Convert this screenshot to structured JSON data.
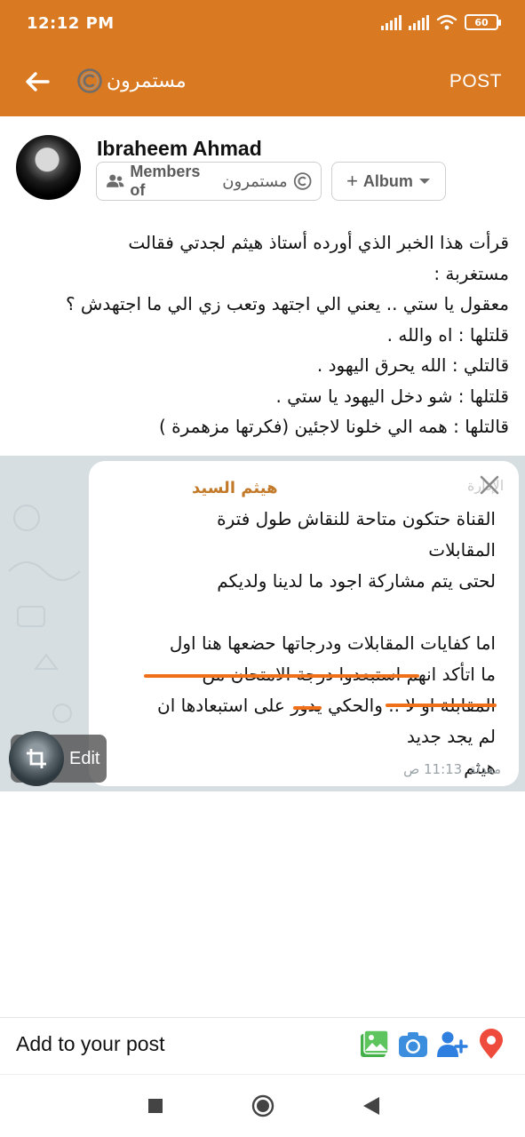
{
  "status_bar": {
    "time": "12:12 PM",
    "battery": "60"
  },
  "header": {
    "back_icon": "arrow-left-icon",
    "title": "مستمرون",
    "post_label": "POST",
    "accent": "#d97a22"
  },
  "author": {
    "name": "Ibraheem Ahmad",
    "audience_label": "Members of",
    "audience_group": "مستمرون",
    "album_label": "Album"
  },
  "post": {
    "lines": [
      "قرأت هذا الخبر الذي أورده أستاذ هيثم لجدتي فقالت",
      "مستغربة :",
      "معقول يا ستي .. يعني الي اجتهد وتعب زي الي ما اجتهدش ؟",
      "قلتلها : اه والله .",
      "قالتلي : الله يحرق اليهود .",
      "قلتلها : شو دخل اليهود يا ستي .",
      "قالتلها : همه الي خلونا لاجئين (فكرتها مزهمرة )"
    ]
  },
  "attached_image": {
    "sender": "هيثم السيد",
    "forward_label": "الإدارة",
    "message_lines": [
      "القناة حتكون متاحة للنقاش طول فترة",
      "المقابلات",
      "لحتى يتم مشاركة اجود ما لدينا ولديكم",
      "",
      "اما كفايات المقابلات ودرجاتها حضعها هنا اول",
      "ما اتأكد انهم استبعدوا درجة الامتحان من",
      "المقابلة او لا .. والحكي يدور على استبعادها ان",
      "لم يجد جديد",
      "هيثم"
    ],
    "edited_label": "معدلة",
    "time": "11:13 ص",
    "edit_label": "Edit"
  },
  "add_bar": {
    "label": "Add to your post",
    "icons": [
      "photo-icon",
      "camera-icon",
      "tag-people-icon",
      "location-pin-icon"
    ]
  },
  "nav": {
    "icons": [
      "recents-square-icon",
      "home-circle-icon",
      "back-triangle-icon"
    ]
  }
}
